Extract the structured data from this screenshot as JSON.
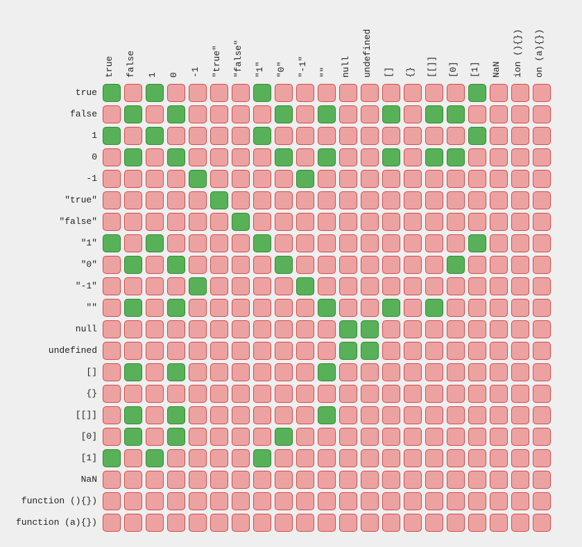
{
  "chart_data": {
    "type": "heatmap",
    "title": "",
    "labels": [
      "true",
      "false",
      "1",
      "0",
      "-1",
      "\"true\"",
      "\"false\"",
      "\"1\"",
      "\"0\"",
      "\"-1\"",
      "\"\"",
      "null",
      "undefined",
      "[]",
      "{}",
      "[[]]",
      "[0]",
      "[1]",
      "NaN",
      "function (){})",
      "function (a){})"
    ],
    "col_labels_rotated": [
      "true",
      "false",
      "1",
      "0",
      "-1",
      "\"true\"",
      "\"false\"",
      "\"1\"",
      "\"0\"",
      "\"-1\"",
      "\"\"",
      "null",
      "undefined",
      "[]",
      "{}",
      "[[]]",
      "[0]",
      "[1]",
      "NaN",
      "ion (){})",
      "on (a){})"
    ],
    "values": [
      [
        1,
        0,
        1,
        0,
        0,
        0,
        0,
        1,
        0,
        0,
        0,
        0,
        0,
        0,
        0,
        0,
        0,
        1,
        0,
        0,
        0
      ],
      [
        0,
        1,
        0,
        1,
        0,
        0,
        0,
        0,
        1,
        0,
        1,
        0,
        0,
        1,
        0,
        1,
        1,
        0,
        0,
        0,
        0
      ],
      [
        1,
        0,
        1,
        0,
        0,
        0,
        0,
        1,
        0,
        0,
        0,
        0,
        0,
        0,
        0,
        0,
        0,
        1,
        0,
        0,
        0
      ],
      [
        0,
        1,
        0,
        1,
        0,
        0,
        0,
        0,
        1,
        0,
        1,
        0,
        0,
        1,
        0,
        1,
        1,
        0,
        0,
        0,
        0
      ],
      [
        0,
        0,
        0,
        0,
        1,
        0,
        0,
        0,
        0,
        1,
        0,
        0,
        0,
        0,
        0,
        0,
        0,
        0,
        0,
        0,
        0
      ],
      [
        0,
        0,
        0,
        0,
        0,
        1,
        0,
        0,
        0,
        0,
        0,
        0,
        0,
        0,
        0,
        0,
        0,
        0,
        0,
        0,
        0
      ],
      [
        0,
        0,
        0,
        0,
        0,
        0,
        1,
        0,
        0,
        0,
        0,
        0,
        0,
        0,
        0,
        0,
        0,
        0,
        0,
        0,
        0
      ],
      [
        1,
        0,
        1,
        0,
        0,
        0,
        0,
        1,
        0,
        0,
        0,
        0,
        0,
        0,
        0,
        0,
        0,
        1,
        0,
        0,
        0
      ],
      [
        0,
        1,
        0,
        1,
        0,
        0,
        0,
        0,
        1,
        0,
        0,
        0,
        0,
        0,
        0,
        0,
        1,
        0,
        0,
        0,
        0
      ],
      [
        0,
        0,
        0,
        0,
        1,
        0,
        0,
        0,
        0,
        1,
        0,
        0,
        0,
        0,
        0,
        0,
        0,
        0,
        0,
        0,
        0
      ],
      [
        0,
        1,
        0,
        1,
        0,
        0,
        0,
        0,
        0,
        0,
        1,
        0,
        0,
        1,
        0,
        1,
        0,
        0,
        0,
        0,
        0
      ],
      [
        0,
        0,
        0,
        0,
        0,
        0,
        0,
        0,
        0,
        0,
        0,
        1,
        1,
        0,
        0,
        0,
        0,
        0,
        0,
        0,
        0
      ],
      [
        0,
        0,
        0,
        0,
        0,
        0,
        0,
        0,
        0,
        0,
        0,
        1,
        1,
        0,
        0,
        0,
        0,
        0,
        0,
        0,
        0
      ],
      [
        0,
        1,
        0,
        1,
        0,
        0,
        0,
        0,
        0,
        0,
        1,
        0,
        0,
        0,
        0,
        0,
        0,
        0,
        0,
        0,
        0
      ],
      [
        0,
        0,
        0,
        0,
        0,
        0,
        0,
        0,
        0,
        0,
        0,
        0,
        0,
        0,
        0,
        0,
        0,
        0,
        0,
        0,
        0
      ],
      [
        0,
        1,
        0,
        1,
        0,
        0,
        0,
        0,
        0,
        0,
        1,
        0,
        0,
        0,
        0,
        0,
        0,
        0,
        0,
        0,
        0
      ],
      [
        0,
        1,
        0,
        1,
        0,
        0,
        0,
        0,
        1,
        0,
        0,
        0,
        0,
        0,
        0,
        0,
        0,
        0,
        0,
        0,
        0
      ],
      [
        1,
        0,
        1,
        0,
        0,
        0,
        0,
        1,
        0,
        0,
        0,
        0,
        0,
        0,
        0,
        0,
        0,
        0,
        0,
        0,
        0
      ],
      [
        0,
        0,
        0,
        0,
        0,
        0,
        0,
        0,
        0,
        0,
        0,
        0,
        0,
        0,
        0,
        0,
        0,
        0,
        0,
        0,
        0
      ],
      [
        0,
        0,
        0,
        0,
        0,
        0,
        0,
        0,
        0,
        0,
        0,
        0,
        0,
        0,
        0,
        0,
        0,
        0,
        0,
        0,
        0
      ],
      [
        0,
        0,
        0,
        0,
        0,
        0,
        0,
        0,
        0,
        0,
        0,
        0,
        0,
        0,
        0,
        0,
        0,
        0,
        0,
        0,
        0
      ]
    ],
    "legend": {
      "true_color": "#58b158",
      "false_color": "#eda2a2"
    }
  }
}
